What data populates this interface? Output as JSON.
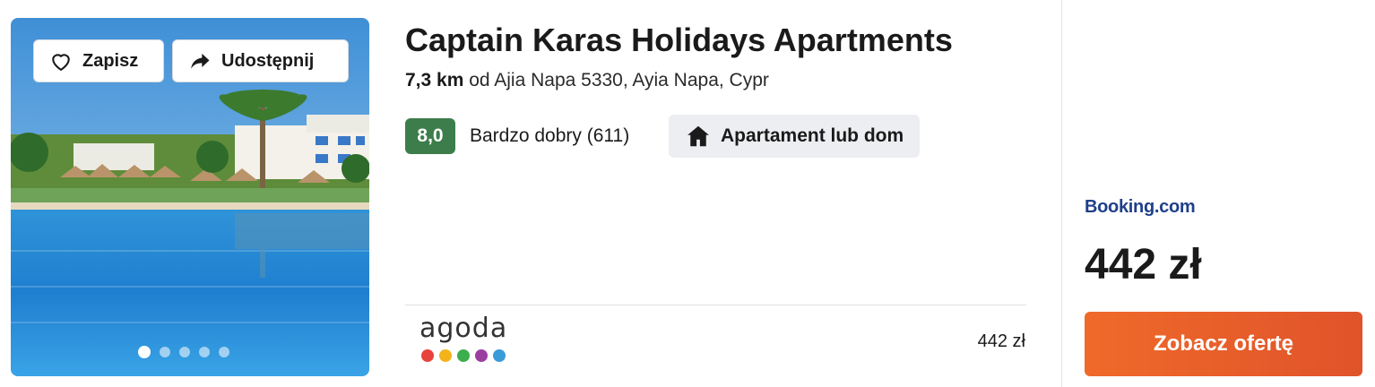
{
  "listing": {
    "title": "Captain Karas Holidays Apartments",
    "distance": "7,3 km",
    "location_rest": " od Ajia Napa 5330, Ayia Napa, Cypr",
    "rating_score": "8,0",
    "rating_text": "Bardzo dobry (611)",
    "property_type": "Apartament lub dom"
  },
  "photo": {
    "save_label": "Zapisz",
    "share_label": "Udostępnij",
    "dot_count": 5,
    "active_dot": 0
  },
  "alternatives": [
    {
      "provider_word": "agoda",
      "price": "442 zł",
      "dot_colors": [
        "#e8423d",
        "#f4b31a",
        "#3cae4d",
        "#9a3fa0",
        "#3b9bd8"
      ]
    }
  ],
  "deal": {
    "provider": "Booking.com",
    "price": "442 zł",
    "cta_label": "Zobacz ofertę"
  },
  "colors": {
    "rating_green": "#3d7d4b",
    "cta_orange": "#ea5f2a",
    "booking_blue": "#1f3f8a"
  },
  "icons": {
    "save": "heart-icon",
    "share": "share-arrow-icon",
    "property_type": "house-icon"
  }
}
